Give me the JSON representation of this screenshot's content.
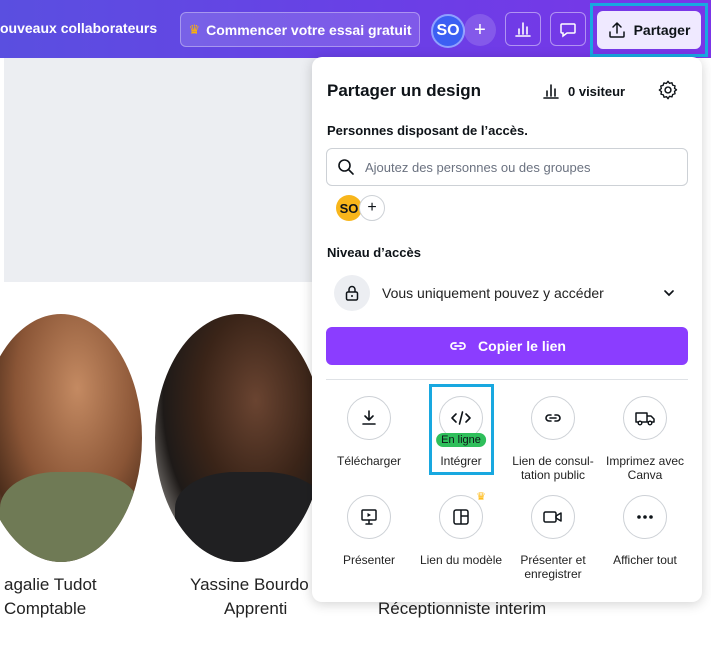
{
  "topbar": {
    "collab_text": "ouveaux collaborateurs",
    "trial_label": "Commencer votre essai gratuit",
    "avatar_initials": "SO",
    "share_label": "Partager"
  },
  "canvas": {
    "people": [
      {
        "name": "agalie Tudot",
        "role": "Comptable"
      },
      {
        "name": "Yassine Bourdo",
        "role": "Apprenti"
      },
      {
        "name": "",
        "role": "Réceptionniste interim"
      }
    ]
  },
  "panel": {
    "title": "Partager un design",
    "visitors": "0 visiteur",
    "people_label": "Personnes disposant de l’accès.",
    "search_placeholder": "Ajoutez des personnes ou des groupes",
    "member_initials": "SO",
    "access_label": "Niveau d’accès",
    "access_value": "Vous uniquement pouvez y accéder",
    "copy_label": "Copier le lien",
    "options": [
      {
        "label": "Télécharger",
        "icon": "download-icon"
      },
      {
        "label": "Intégrer",
        "icon": "embed-code-icon",
        "badge": "En ligne"
      },
      {
        "label": "Lien de consul-tation public",
        "icon": "link-icon"
      },
      {
        "label": "Imprimez avec Canva",
        "icon": "truck-icon"
      },
      {
        "label": "Présenter",
        "icon": "present-icon"
      },
      {
        "label": "Lien du modèle",
        "icon": "template-icon"
      },
      {
        "label": "Présenter et enregistrer",
        "icon": "camera-icon"
      },
      {
        "label": "Afficher tout",
        "icon": "more-icon"
      }
    ]
  },
  "colors": {
    "topbar_start": "#5a4fe0",
    "topbar_end": "#7b35e8",
    "primary_button": "#8b3dff",
    "highlight_border": "#18a8e0",
    "badge_green": "#2fbf5b"
  }
}
